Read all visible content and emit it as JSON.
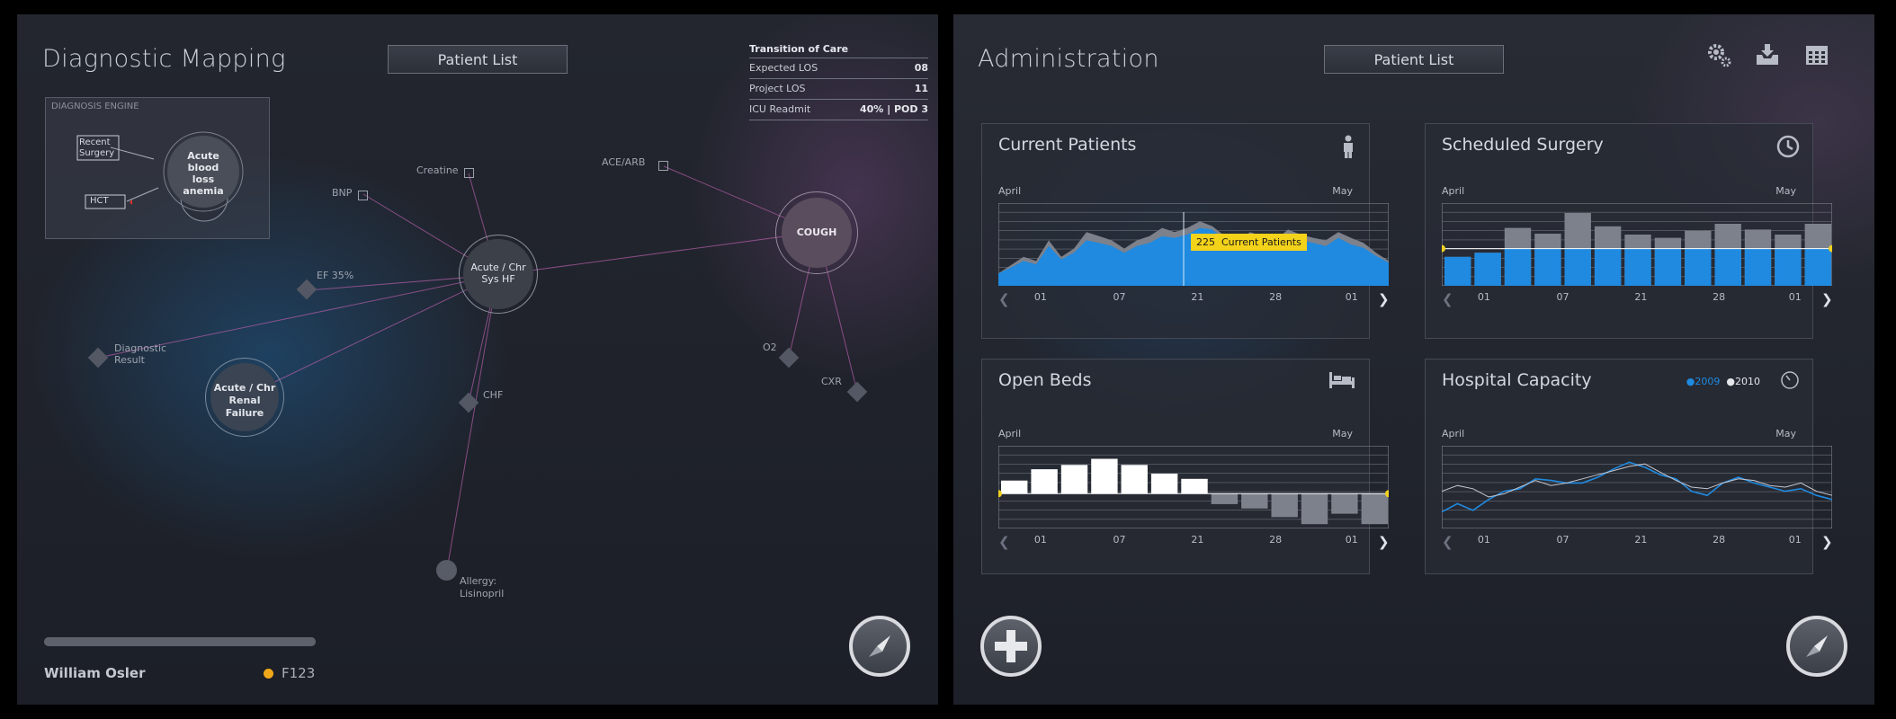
{
  "left": {
    "title": "Diagnostic Mapping",
    "patient_list_label": "Patient List",
    "transition_of_care": {
      "heading": "Transition of Care",
      "rows": [
        {
          "label": "Expected LOS",
          "value": "08"
        },
        {
          "label": "Project LOS",
          "value": "11"
        },
        {
          "label": "ICU Readmit",
          "value": "40% | POD 3"
        }
      ]
    },
    "diagnosis_engine": {
      "label": "DIAGNOSIS ENGINE",
      "recent_surgery": "Recent Surgery",
      "hct": "HCT",
      "acute": "Acute blood loss anemia"
    },
    "nodes": {
      "hf": "Acute / Chr Sys HF",
      "renal": "Acute / Chr Renal Failure",
      "cough": "COUGH",
      "creatine": "Creatine",
      "bnp": "BNP",
      "ace": "ACE/ARB",
      "ef": "EF 35%",
      "diag_result": "Diagnostic Result",
      "chf": "CHF",
      "allergy": "Allergy: Lisinopril",
      "o2": "O2",
      "cxr": "CXR"
    },
    "patient": {
      "name": "William Osler",
      "id": "F123",
      "status_color": "#f0a81a"
    },
    "progress": 1.0
  },
  "right": {
    "title": "Administration",
    "patient_list_label": "Patient List",
    "toolbar_icons": [
      "gear-icon",
      "download-icon",
      "calendar-icon"
    ],
    "month_start": "April",
    "month_end": "May",
    "ticks": [
      "01",
      "07",
      "21",
      "28",
      "01"
    ],
    "cards": {
      "current": {
        "title": "Current Patients",
        "icon": "person-icon",
        "tooltip_value": "225",
        "tooltip_label": "Current Patients"
      },
      "surgery": {
        "title": "Scheduled Surgery",
        "icon": "clock-icon"
      },
      "beds": {
        "title": "Open Beds",
        "icon": "bed-icon"
      },
      "capacity": {
        "title": "Hospital Capacity",
        "icon": "gauge-icon",
        "legend": [
          {
            "name": "2009",
            "color": "#1f8ae0"
          },
          {
            "name": "2010",
            "color": "#e4e6ea"
          }
        ]
      }
    }
  },
  "chart_data": [
    {
      "type": "area",
      "name_ref": "Current Patients",
      "x": [
        0,
        1,
        2,
        3,
        4,
        5,
        6,
        7,
        8,
        9,
        10,
        11,
        12,
        13,
        14,
        15,
        16,
        17,
        18,
        19,
        20,
        21,
        22,
        23,
        24,
        25,
        26,
        27,
        28,
        29,
        30,
        31
      ],
      "series": [
        {
          "values": [
            15,
            25,
            35,
            30,
            55,
            35,
            45,
            65,
            60,
            55,
            45,
            55,
            60,
            70,
            65,
            70,
            78,
            72,
            60,
            55,
            65,
            60,
            55,
            68,
            62,
            58,
            55,
            65,
            58,
            52,
            40,
            30
          ]
        },
        {
          "values": [
            15,
            22,
            30,
            26,
            48,
            32,
            40,
            55,
            52,
            48,
            40,
            48,
            52,
            60,
            58,
            62,
            70,
            68,
            55,
            50,
            58,
            54,
            50,
            60,
            55,
            52,
            48,
            58,
            50,
            46,
            36,
            28
          ]
        }
      ],
      "ylim": [
        0,
        100
      ]
    },
    {
      "type": "bar",
      "name_ref": "Scheduled Surgery",
      "series": [
        {
          "values": [
            35,
            40,
            70,
            63,
            88,
            72,
            62,
            58,
            67,
            75,
            68,
            62,
            75
          ]
        },
        {
          "values": [
            35,
            40,
            45,
            45,
            45,
            45,
            45,
            45,
            45,
            45,
            45,
            45,
            45
          ]
        }
      ],
      "reference": 45,
      "ylim": [
        0,
        100
      ]
    },
    {
      "type": "bar",
      "name_ref": "Open Beds",
      "values": [
        15,
        28,
        33,
        40,
        33,
        23,
        17,
        -12,
        -17,
        -27,
        -35,
        -23,
        -35
      ],
      "ylim": [
        -40,
        55
      ]
    },
    {
      "type": "line",
      "name_ref": "Hospital Capacity",
      "series": [
        {
          "name": "2009",
          "values": [
            20,
            30,
            22,
            35,
            45,
            48,
            60,
            58,
            55,
            55,
            62,
            72,
            80,
            74,
            65,
            60,
            45,
            40,
            55,
            62,
            55,
            50,
            45,
            48,
            40,
            35
          ]
        },
        {
          "name": "2010",
          "values": [
            45,
            52,
            48,
            38,
            42,
            50,
            58,
            52,
            55,
            60,
            65,
            70,
            75,
            78,
            68,
            58,
            50,
            48,
            55,
            60,
            58,
            52,
            50,
            55,
            45,
            40
          ]
        }
      ],
      "ylim": [
        0,
        100
      ]
    }
  ]
}
